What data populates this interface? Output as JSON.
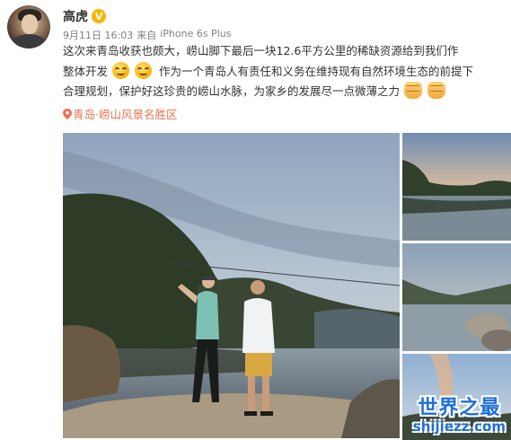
{
  "post": {
    "username": "高虎",
    "verified_badge": "V",
    "meta": {
      "date": "9月11日 16:03",
      "source_prefix": "来自",
      "source_device": "iPhone 6s Plus"
    },
    "content": {
      "line1": "这次来青岛收获也颇大，崂山脚下最后一块12.6平方公里的稀缺资源给到我们作",
      "line2_a": "整体开发",
      "line2_b": "作为一个青岛人有责任和义务在维持现有自然环境生态的前提下",
      "line3": "合理规划，保护好这珍贵的崂山水脉，为家乡的发展尽一点微薄之力"
    },
    "emoji": {
      "smile": "smile-emoji",
      "fist": "fist-emoji"
    },
    "location": "青岛·崂山风景名胜区",
    "location_color": "#eb7350"
  },
  "watermark": {
    "title": "世界之最",
    "url": "shijiezz.com",
    "color": "#1e6fd8"
  }
}
